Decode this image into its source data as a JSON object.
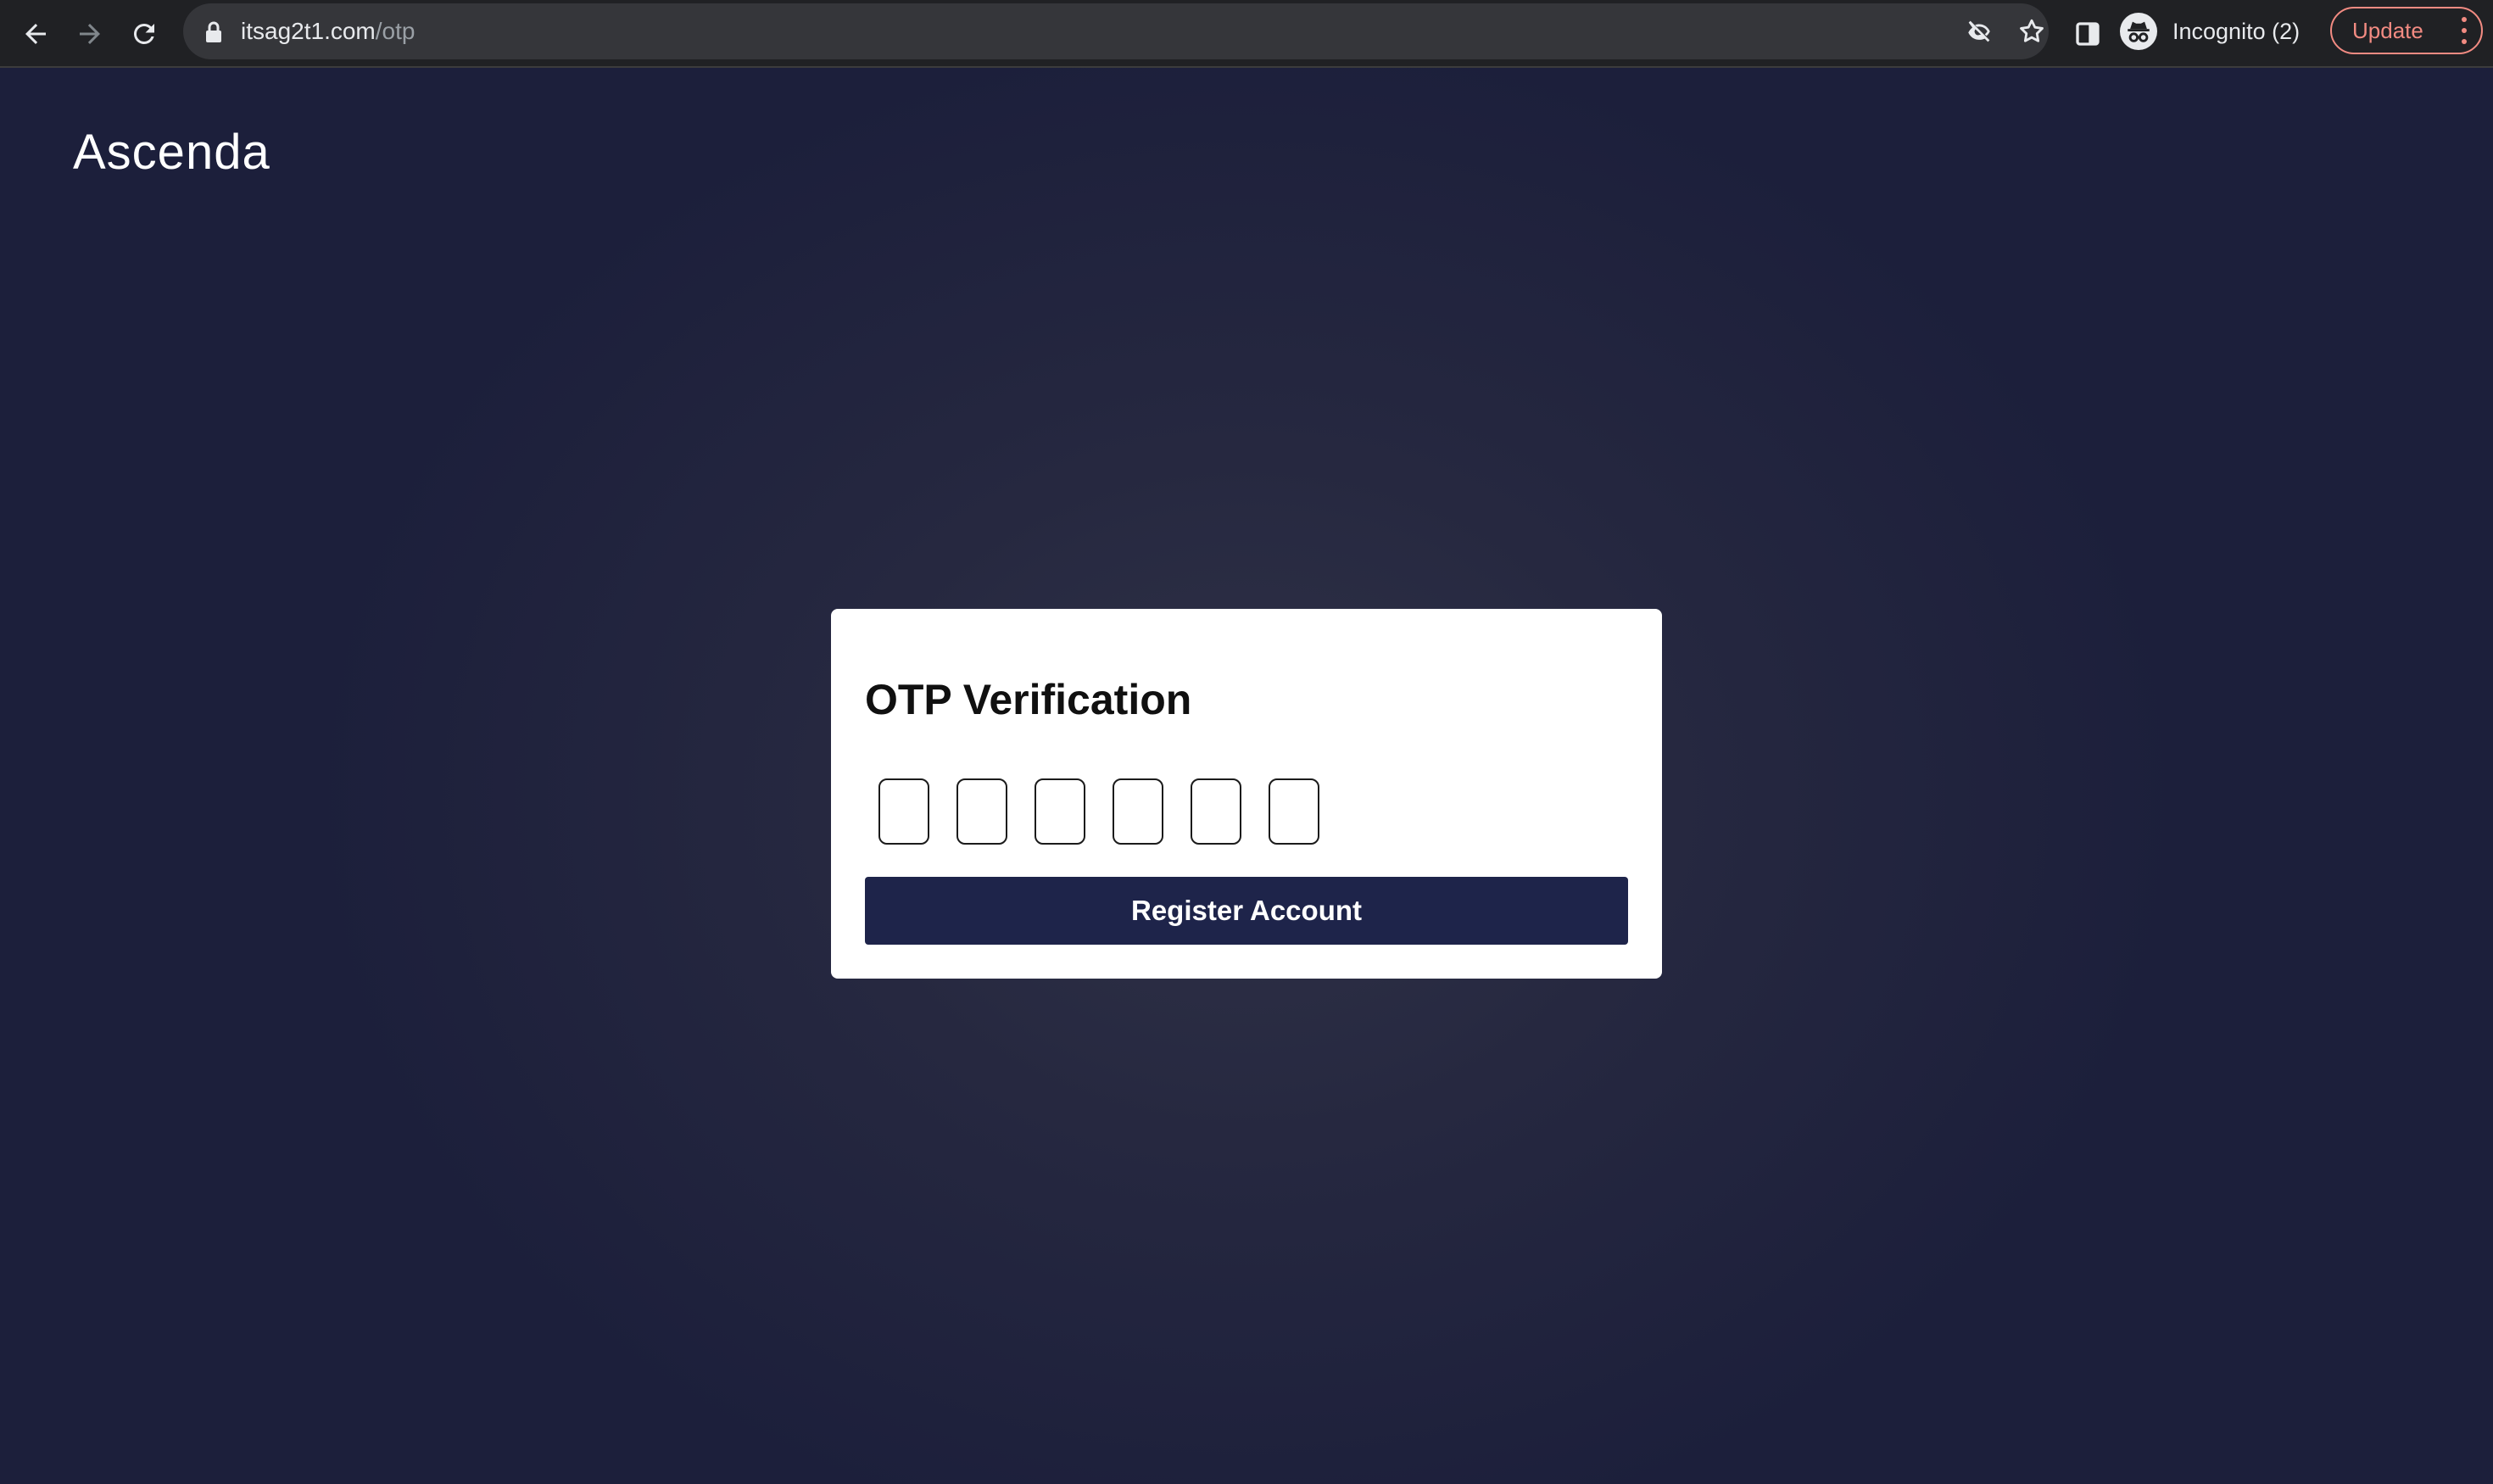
{
  "browser": {
    "url_host": "itsag2t1.com",
    "url_path": "/otp",
    "profile_label": "Incognito (2)",
    "update_label": "Update",
    "icons": {
      "back": "arrow-left",
      "forward": "arrow-right",
      "reload": "reload",
      "lock": "lock",
      "eye_off": "eye-slash",
      "bookmark": "star",
      "side_panel": "side-panel",
      "incognito": "incognito",
      "menu": "three-dots-vertical"
    }
  },
  "page": {
    "logo": "Ascenda",
    "card": {
      "title": "OTP Verification",
      "otp_values": [
        "",
        "",
        "",
        "",
        "",
        ""
      ],
      "submit_label": "Register Account"
    }
  },
  "colors": {
    "background": "#1c1f3b",
    "button": "#1e244a",
    "update_accent": "#f28b82"
  }
}
